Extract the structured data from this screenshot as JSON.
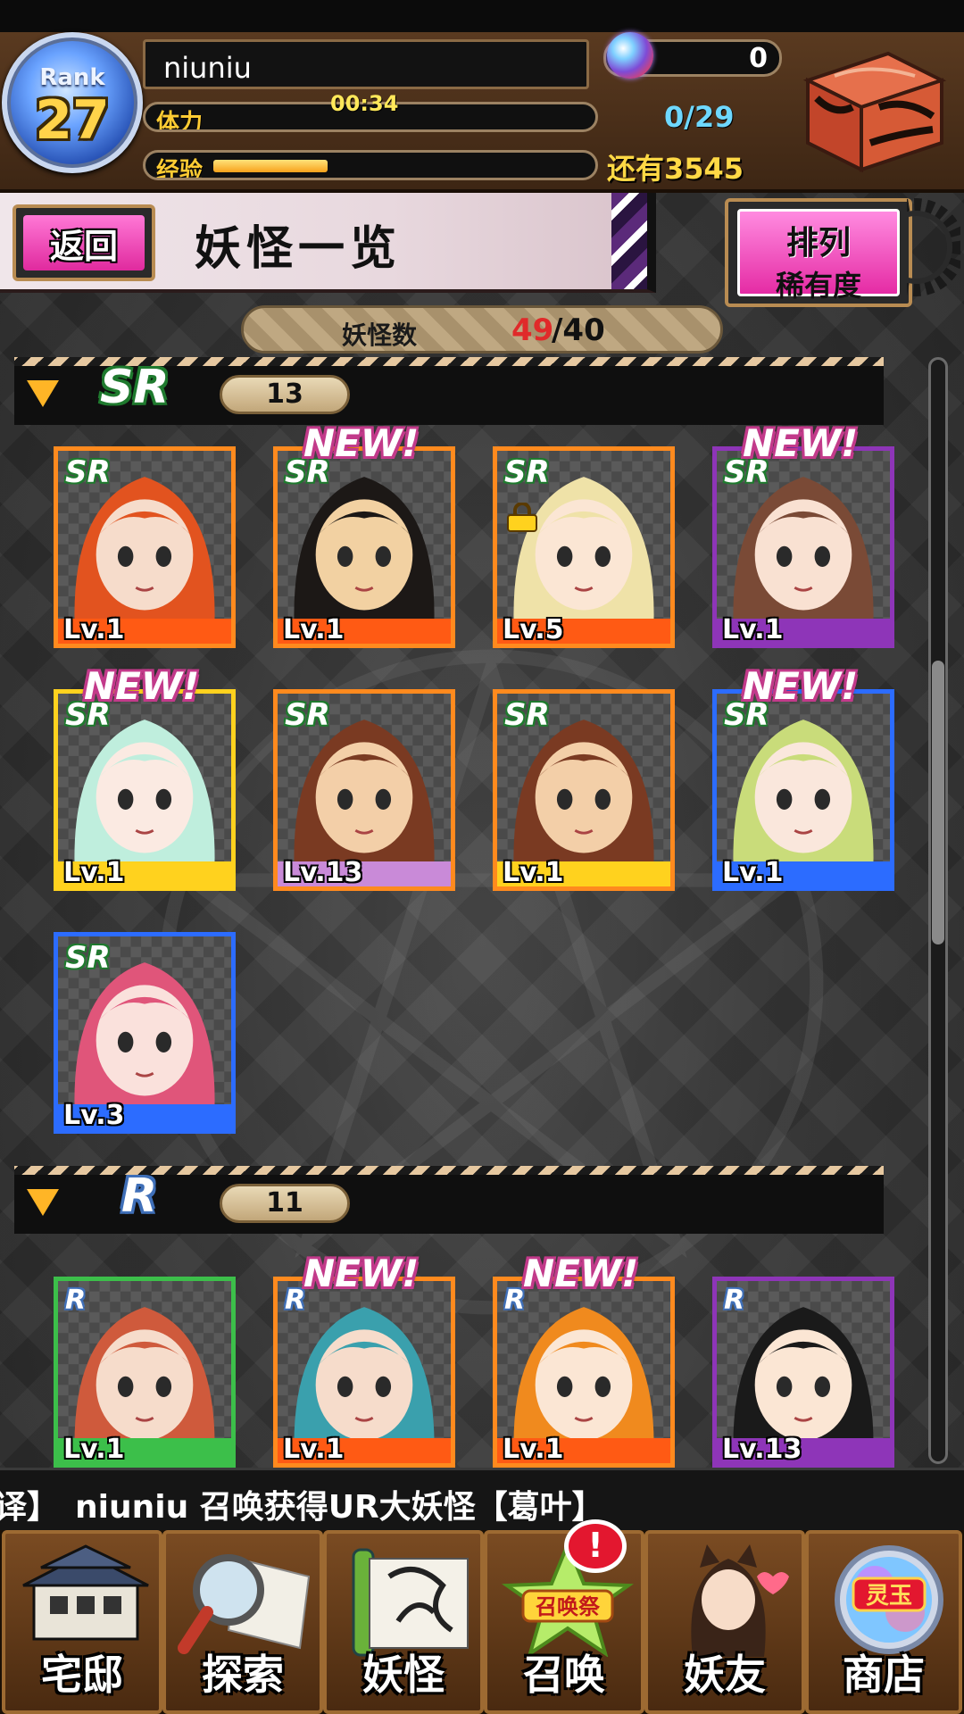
{
  "header": {
    "rank_label": "Rank",
    "rank_value": "27",
    "player_name": "niuniu",
    "stamina_label": "体力",
    "stamina_timer": "00:34",
    "exp_label": "经验",
    "exp_fraction": 0.32,
    "orb_count": "0",
    "stamina_value": "0/29",
    "remaining_text": "还有3545"
  },
  "titlebar": {
    "back_label": "返回",
    "title": "妖怪一览",
    "sort_line1": "排列",
    "sort_line2": "稀有度"
  },
  "count": {
    "label": "妖怪数",
    "current": "49",
    "max": "/40"
  },
  "sections": [
    {
      "rarity": "SR",
      "count": "13",
      "cards": [
        {
          "badge": "SR",
          "level": "Lv.1",
          "new": false,
          "locked": false,
          "frame": "#ff8a1e",
          "bar": "#ff5a14",
          "hair": "#e2531f",
          "skin": "#f6dccb"
        },
        {
          "badge": "SR",
          "level": "Lv.1",
          "new": true,
          "locked": false,
          "frame": "#ff8a1e",
          "bar": "#ff5a14",
          "hair": "#1c1816",
          "skin": "#f2d1a2"
        },
        {
          "badge": "SR",
          "level": "Lv.5",
          "new": false,
          "locked": true,
          "frame": "#ff8a1e",
          "bar": "#ff5a14",
          "hair": "#efe2a8",
          "skin": "#fbe6d4"
        },
        {
          "badge": "SR",
          "level": "Lv.1",
          "new": true,
          "locked": false,
          "frame": "#8e35b8",
          "bar": "#8e35b8",
          "hair": "#7a4a36",
          "skin": "#f9e1d2"
        },
        {
          "badge": "SR",
          "level": "Lv.1",
          "new": true,
          "locked": false,
          "frame": "#ffd21e",
          "bar": "#ffd21e",
          "hair": "#bfeedd",
          "skin": "#fbeae2"
        },
        {
          "badge": "SR",
          "level": "Lv.13",
          "new": false,
          "locked": false,
          "frame": "#ff8a1e",
          "bar": "#c98ad8",
          "hair": "#7a3a22",
          "skin": "#f3cfa8"
        },
        {
          "badge": "SR",
          "level": "Lv.1",
          "new": false,
          "locked": false,
          "frame": "#ff8a1e",
          "bar": "#ffd21e",
          "hair": "#7a3a22",
          "skin": "#f3cfa8"
        },
        {
          "badge": "SR",
          "level": "Lv.1",
          "new": true,
          "locked": false,
          "frame": "#2c6cff",
          "bar": "#2c6cff",
          "hair": "#c9dc7a",
          "skin": "#fae7dc"
        },
        {
          "badge": "SR",
          "level": "Lv.3",
          "new": false,
          "locked": false,
          "frame": "#2c6cff",
          "bar": "#2c6cff",
          "hair": "#e0557a",
          "skin": "#fae1dc"
        }
      ]
    },
    {
      "rarity": "R",
      "count": "11",
      "cards": [
        {
          "badge": "R",
          "level": "Lv.1",
          "new": false,
          "locked": false,
          "frame": "#3cbf4a",
          "bar": "#3cbf4a",
          "hair": "#cf5a3c",
          "skin": "#f6dccb"
        },
        {
          "badge": "R",
          "level": "Lv.1",
          "new": true,
          "locked": false,
          "frame": "#ff8a1e",
          "bar": "#ff5a14",
          "hair": "#3aa0ad",
          "skin": "#f6dccb"
        },
        {
          "badge": "R",
          "level": "Lv.1",
          "new": true,
          "locked": false,
          "frame": "#ff8a1e",
          "bar": "#ff5a14",
          "hair": "#f08a1e",
          "skin": "#fbe6d4"
        },
        {
          "badge": "R",
          "level": "Lv.13",
          "new": false,
          "locked": false,
          "frame": "#8e35b8",
          "bar": "#8e35b8",
          "hair": "#1a1a1a",
          "skin": "#fbe6d4"
        }
      ]
    }
  ],
  "new_label": "NEW!",
  "ticker_text": "译】　niuniu 召唤获得UR大妖怪【葛叶】",
  "nav": [
    {
      "label": "宅邸",
      "icon": "mansion-icon"
    },
    {
      "label": "探索",
      "icon": "magnifier-map-icon"
    },
    {
      "label": "妖怪",
      "icon": "scroll-icon"
    },
    {
      "label": "召唤",
      "icon": "summon-star-icon",
      "sub": "召唤祭"
    },
    {
      "label": "妖友",
      "icon": "friend-girl-icon"
    },
    {
      "label": "商店",
      "icon": "spirit-orb-icon",
      "sub": "灵玉"
    }
  ],
  "alert_symbol": "!"
}
